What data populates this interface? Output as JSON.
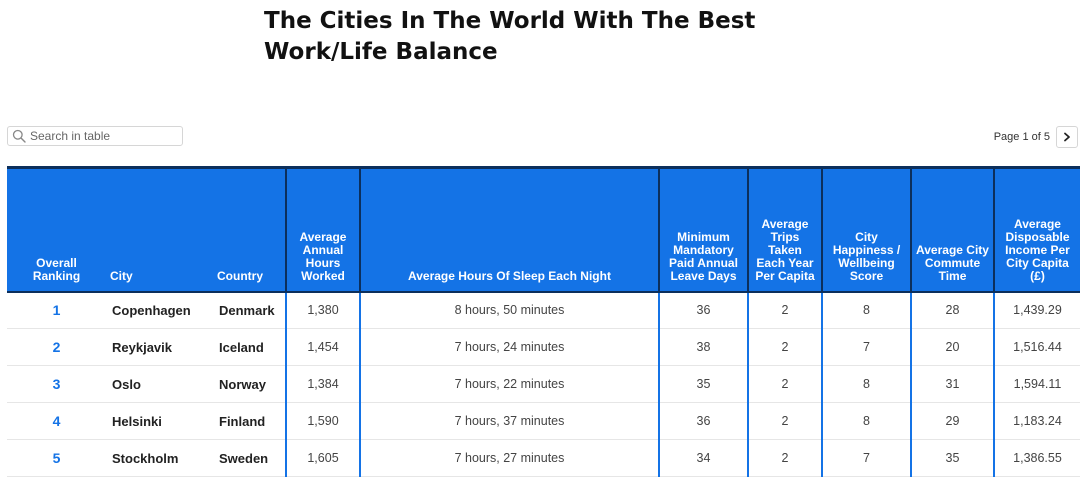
{
  "title": "The Cities In The World With The Best Work/Life Balance",
  "search": {
    "placeholder": "Search in table",
    "icon": "search-icon"
  },
  "pagination": {
    "label": "Page 1 of 5",
    "next_icon": "chevron-right-icon"
  },
  "colors": {
    "header_bg": "#1473e6",
    "header_border": "#0c2f5c",
    "rank": "#1473e6"
  },
  "table": {
    "headers": [
      "Overall Ranking",
      "City",
      "Country",
      "Average Annual Hours Worked",
      "Average Hours Of Sleep Each Night",
      "Minimum Mandatory Paid Annual Leave Days",
      "Average Trips Taken Each Year Per Capita",
      "City Happiness / Wellbeing Score",
      "Average City Commute Time",
      "Average Disposable Income Per City Capita (£)"
    ],
    "rows": [
      [
        "1",
        "Copenhagen",
        "Denmark",
        "1,380",
        "8 hours, 50 minutes",
        "36",
        "2",
        "8",
        "28",
        "1,439.29"
      ],
      [
        "2",
        "Reykjavik",
        "Iceland",
        "1,454",
        "7 hours, 24 minutes",
        "38",
        "2",
        "7",
        "20",
        "1,516.44"
      ],
      [
        "3",
        "Oslo",
        "Norway",
        "1,384",
        "7 hours, 22 minutes",
        "35",
        "2",
        "8",
        "31",
        "1,594.11"
      ],
      [
        "4",
        "Helsinki",
        "Finland",
        "1,590",
        "7 hours, 37 minutes",
        "36",
        "2",
        "8",
        "29",
        "1,183.24"
      ],
      [
        "5",
        "Stockholm",
        "Sweden",
        "1,605",
        "7 hours, 27 minutes",
        "34",
        "2",
        "7",
        "35",
        "1,386.55"
      ]
    ]
  }
}
